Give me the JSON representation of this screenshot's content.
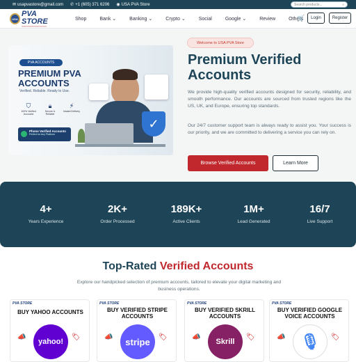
{
  "topbar": {
    "email": "usapvastore@gmail.com",
    "phone": "+1 (605) 371 6206",
    "brand_link": "USA PVA Store",
    "search_placeholder": "Search products..."
  },
  "logo": {
    "badge": "USA",
    "name": "PVA STORE"
  },
  "nav": {
    "items": [
      "Shop",
      "Bank",
      "Banking",
      "Crypto",
      "Social",
      "Google",
      "Review",
      "Others"
    ],
    "dropdown_items": [
      "Bank",
      "Banking",
      "Crypto",
      "Google"
    ],
    "login": "Login",
    "register": "Register"
  },
  "hero": {
    "pill": "Welcome to USA PVA Store",
    "title": "Premium Verified Accounts",
    "p1": "We provide high-quality verified accounts designed for security, reliability, and smooth performance. Our accounts are sourced from trusted regions like the US, UK, and Europe, ensuring top standards.",
    "p2": "Our 24/7 customer support team is always ready to assist you. Your success is our priority, and we are committed to delivering a service you can rely on.",
    "browse": "Browse Verified Accounts",
    "learn": "Learn More",
    "image": {
      "tag": "PVA ACCOUNTS",
      "headline1": "PREMIUM PVA",
      "headline2": "ACCOUNTS",
      "tagline": "Verified. Reliable. Ready to Use.",
      "features": [
        "100% Verified Accounts",
        "Secure & Reliable",
        "Instant Delivery"
      ],
      "phone_title": "Phone Verified Accounts",
      "phone_sub": "Perfect for Any Platform"
    }
  },
  "stats": [
    {
      "value": "4+",
      "label": "Years Experience"
    },
    {
      "value": "2K+",
      "label": "Order Processed"
    },
    {
      "value": "189K+",
      "label": "Active Clients"
    },
    {
      "value": "1M+",
      "label": "Lead Generated"
    },
    {
      "value": "16/7",
      "label": "Live Support"
    }
  ],
  "section": {
    "title_a": "Top-Rated ",
    "title_b": "Verified Accounts",
    "desc": "Explore our handpicked selection of premium accounts, tailored to elevate your digital marketing and business operations."
  },
  "cards": [
    {
      "logo": "PVA STORE",
      "title": "BUY YAHOO ACCOUNTS",
      "brand": "yahoo!",
      "color": "#6001d2"
    },
    {
      "logo": "PVA STORE",
      "title": "BUY VERIFIED STRIPE ACCOUNTS",
      "brand": "stripe",
      "color": "#635bff"
    },
    {
      "logo": "PVA STORE",
      "title": "BUY VERIFIED SKRILL ACCOUNTS",
      "brand": "Skrill",
      "color": "#862165"
    },
    {
      "logo": "PVA STORE",
      "title": "BUY VERIFIED GOOGLE VOICE ACCOUNTS",
      "brand": "voice",
      "color": "#ffffff"
    }
  ],
  "colors": {
    "primary": "#1d4557",
    "accent": "#c0282d"
  }
}
